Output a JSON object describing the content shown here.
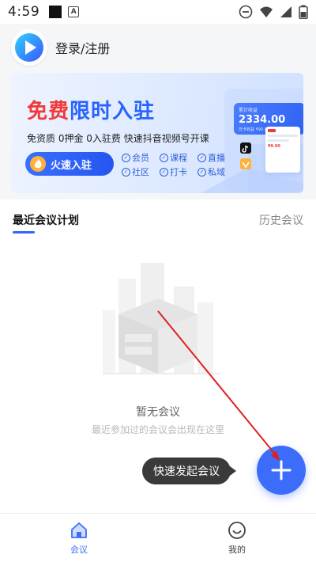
{
  "status_bar": {
    "time": "4:59",
    "square_icon": "square-icon",
    "a_icon": "A"
  },
  "header": {
    "login_label": "登录/注册"
  },
  "banner": {
    "title_red": "免费",
    "title_blue": "限时入驻",
    "subtitle": "免资质 0押金 0入驻费 快速抖音视频号开课",
    "button_label": "火速入驻",
    "features": [
      "会员",
      "课程",
      "直播",
      "社区",
      "打卡",
      "私域"
    ],
    "stats_label": "累计收益",
    "stats_value": "2334.00",
    "stats_row": "日卡收益 ¥90.00   昨日收益 ¥8.00",
    "price_tag": "¥9.90",
    "colors": {
      "red": "#f03a3a",
      "blue": "#2763ff"
    }
  },
  "tabs": {
    "recent": "最近会议计划",
    "history": "历史会议"
  },
  "empty": {
    "title": "暂无会议",
    "desc": "最近参加过的会议会出现在这里"
  },
  "tooltip": "快速发起会议",
  "bottom_nav": {
    "meeting": "会议",
    "mine": "我的"
  },
  "colors": {
    "accent": "#3b6dfa",
    "annotation_arrow": "#e02020"
  }
}
